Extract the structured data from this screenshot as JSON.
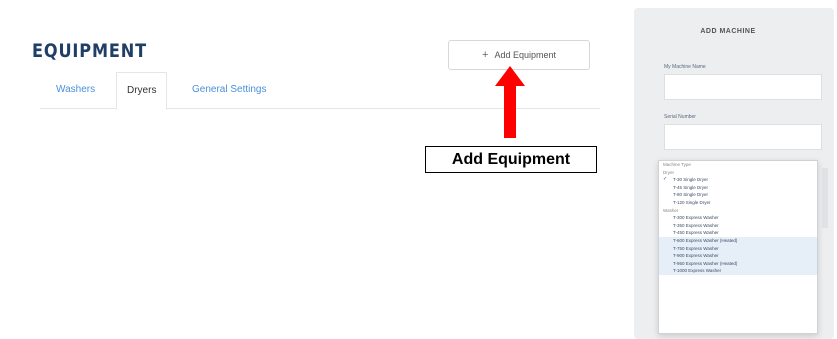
{
  "page": {
    "title": "EQUIPMENT"
  },
  "tabs": [
    {
      "label": "Washers",
      "active": false
    },
    {
      "label": "Dryers",
      "active": true
    },
    {
      "label": "General Settings",
      "active": false
    }
  ],
  "add_button": {
    "icon": "plus-icon",
    "label": "Add Equipment"
  },
  "annotation": {
    "label": "Add Equipment",
    "arrow_color": "#ff0000"
  },
  "panel": {
    "title": "ADD MACHINE",
    "fields": [
      {
        "label": "My Machine Name",
        "value": ""
      },
      {
        "label": "Serial Number",
        "value": ""
      }
    ],
    "dropdown": {
      "items": [
        {
          "label": "Machine Type",
          "type": "header"
        },
        {
          "label": "Dryer",
          "type": "group"
        },
        {
          "label": "T-30 Single Dryer",
          "selected": true
        },
        {
          "label": "T-45 Single Dryer"
        },
        {
          "label": "T-80 Single Dryer"
        },
        {
          "label": "T-120 Single Dryer"
        },
        {
          "label": "Washer",
          "type": "group"
        },
        {
          "label": "T-300 Express Washer"
        },
        {
          "label": "T-350 Express Washer"
        },
        {
          "label": "T-450 Express Washer"
        },
        {
          "label": "T-600 Express Washer (Heated)",
          "highlight": true
        },
        {
          "label": "T-750 Express Washer",
          "highlight": true
        },
        {
          "label": "T-900 Express Washer",
          "highlight": true
        },
        {
          "label": "T-950 Express Washer (Heated)",
          "highlight": true
        },
        {
          "label": "T-1000 Express Washer",
          "highlight": true
        }
      ]
    }
  }
}
